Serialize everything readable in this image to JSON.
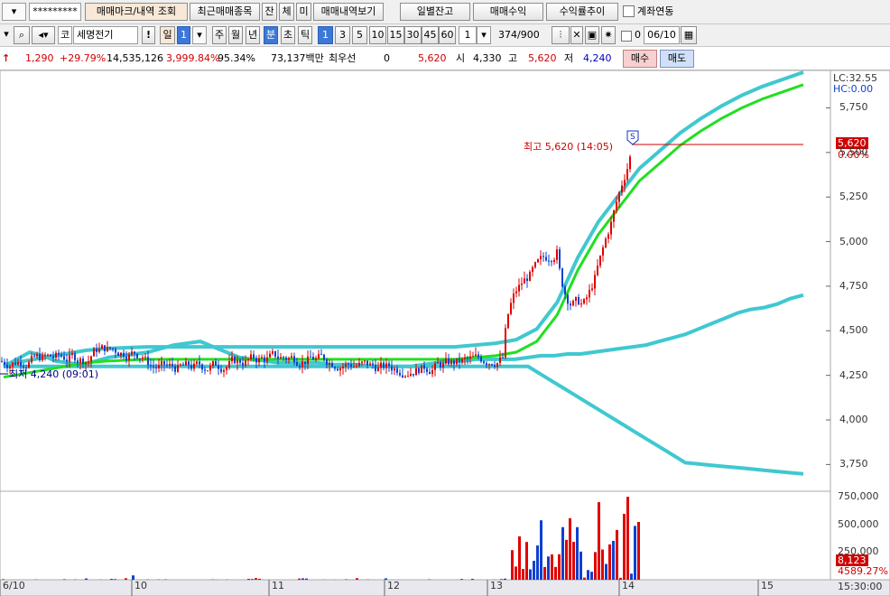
{
  "toolbar1": {
    "password_mask": "*********",
    "buttons": [
      "매매마크/내역 조회",
      "최근매매종목",
      "잔",
      "체",
      "미",
      "매매내역보기",
      "일별잔고",
      "매매수익",
      "수익률추이"
    ],
    "account_link_label": "계좌연동"
  },
  "toolbar2": {
    "market_prefix": "코",
    "stock_name": "세명전기",
    "exclamation": "!",
    "period_day": "일",
    "period_day_value": "1",
    "periods": [
      "주",
      "월",
      "년",
      "분",
      "초",
      "틱"
    ],
    "minute_options": [
      "1",
      "3",
      "5",
      "10",
      "15",
      "30",
      "45",
      "60"
    ],
    "interval_value": "1",
    "count": "374",
    "total": "/900",
    "zero_label": "0",
    "date_value": "06/10"
  },
  "quote": {
    "change": "1,290",
    "change_pct": "+29.79%",
    "volume": "14,535,126",
    "volume_pct": "3,999.84%",
    "rate": "95.34%",
    "amount": "73,137백만",
    "best_label": "최우선",
    "best_value": "0",
    "price": "5,620",
    "open_label": "시",
    "open": "4,330",
    "high_label": "고",
    "high": "5,620",
    "low_label": "저",
    "low": "4,240",
    "buy_label": "매수",
    "sell_label": "매도"
  },
  "chart": {
    "lc_label": "LC:32.55",
    "hc_label": "HC:0.00",
    "high_annotation": "최고 5,620 (14:05)",
    "low_annotation": "최저 4,240 (09:01)",
    "marker_letter": "S",
    "current_price_tag": "5,620",
    "current_pct_tag": "0.00%",
    "volume_tag": "8,123",
    "volume_pct_tag": "4589.27%",
    "time_label": "15:30:00",
    "colors": {
      "up": "#e00000",
      "down": "#1040d0",
      "band": "#40c8d0",
      "ma": "#20e020"
    }
  },
  "chart_data": [
    {
      "type": "candlestick",
      "y_ticks": [
        "5,750",
        "5,500",
        "5,250",
        "5,000",
        "4,750",
        "4,500",
        "4,250",
        "4,000",
        "3,750"
      ],
      "x_ticks": [
        "6/10",
        "10",
        "11",
        "12",
        "13",
        "14",
        "15"
      ],
      "ylim": [
        3600,
        5960
      ],
      "high": 5620,
      "low": 4240,
      "last": 5620,
      "series": [
        {
          "values": [
            4300,
            4340,
            4380,
            4360,
            4330,
            4320,
            4310,
            4330,
            4350,
            4360,
            4370,
            4380,
            4400,
            4420,
            4430,
            4440,
            4410,
            4380,
            4350,
            4340,
            4330,
            4320,
            4320,
            4320,
            4320,
            4310,
            4310,
            4310,
            4300,
            4300,
            4300,
            4300,
            4310,
            4320,
            4330,
            4330,
            4340,
            4340,
            4340,
            4340,
            4350,
            4360,
            4360,
            4370,
            4370,
            4380,
            4390,
            4400,
            4410,
            4420,
            4440,
            4460,
            4480,
            4510,
            4540,
            4570,
            4600,
            4620,
            4630,
            4650,
            4680,
            4700
          ]
        },
        {
          "values": [
            4300,
            4320,
            4340,
            4360,
            4380,
            4390,
            4395,
            4400,
            4400,
            4400,
            4400,
            4400,
            4400,
            4400,
            4400,
            4400,
            4400,
            4400,
            4400,
            4400,
            4400,
            4400,
            4400,
            4410,
            4420,
            4440,
            4500,
            4650,
            4900,
            5100,
            5250,
            5400,
            5500,
            5600,
            5680,
            5750,
            5810,
            5860,
            5900,
            5940
          ]
        }
      ]
    },
    {
      "type": "bar",
      "y_ticks": [
        "750,000",
        "500,000",
        "250,000"
      ],
      "ylim": [
        0,
        800000
      ]
    }
  ]
}
